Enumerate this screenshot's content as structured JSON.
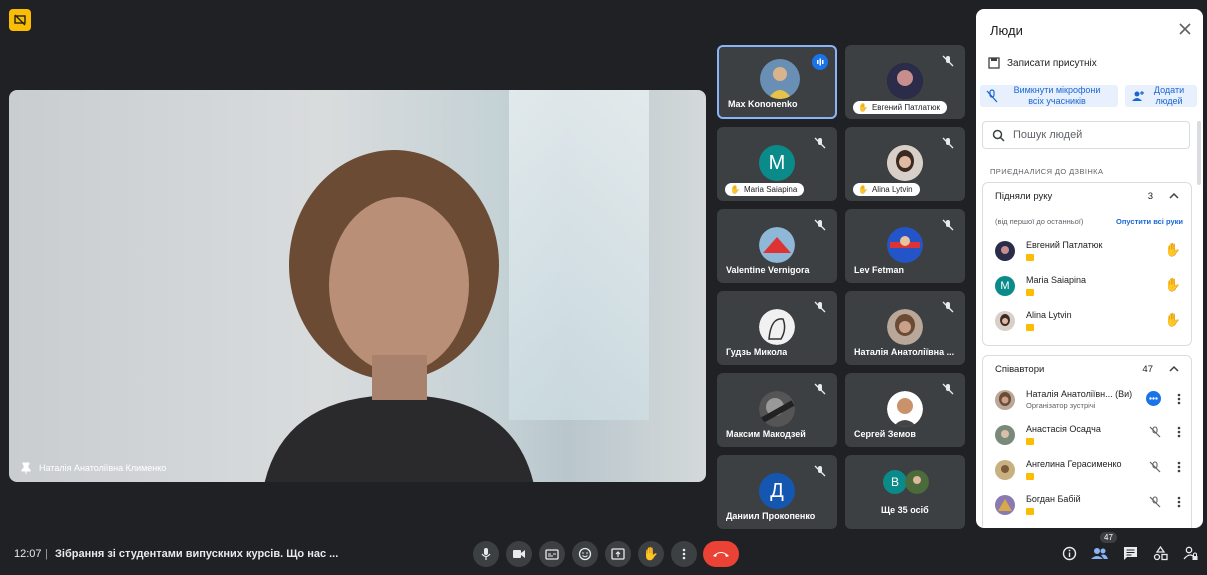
{
  "main_video": {
    "name": "Наталія Анатоліївна Клименко"
  },
  "tiles": [
    {
      "name": "Max Kononenko",
      "speaking": true
    },
    {
      "name": "Евгений Патлатюк",
      "hand_raised": true
    },
    {
      "name": "Maria Saiapina",
      "hand_raised": true,
      "initial": "M"
    },
    {
      "name": "Alina Lytvin",
      "hand_raised": true
    },
    {
      "name": "Valentine Vernigora"
    },
    {
      "name": "Lev Fetman"
    },
    {
      "name": "Гудзь Микола"
    },
    {
      "name": "Наталія Анатоліївна ..."
    },
    {
      "name": "Максим Макодзей"
    },
    {
      "name": "Сергей Земов"
    },
    {
      "name": "Даниил Прокопенко",
      "initial": "Д"
    },
    {
      "name": "Ще 35 осіб",
      "initial": "B"
    }
  ],
  "panel": {
    "title": "Люди",
    "record_label": "Записати присутніх",
    "mute_all_label": "Вимкнути мікрофони всіх учасників",
    "add_label": "Додати людей",
    "search_placeholder": "Пошук людей",
    "section_label": "ПРИЄДНАЛИСЯ ДО ДЗВІНКА",
    "raised": {
      "title": "Підняли руку",
      "count": "3",
      "order_text": "(від першої до останньої)",
      "lower_all": "Опустити всі руки",
      "people": [
        {
          "name": "Евгений Патлатюк"
        },
        {
          "name": "Maria Saiapina",
          "initial": "M"
        },
        {
          "name": "Alina Lytvin"
        }
      ]
    },
    "participants": {
      "title": "Співавтори",
      "count": "47",
      "people": [
        {
          "name": "Наталія Анатоліївн...",
          "you": "(Ви)",
          "sub": "Організатор зустрічі"
        },
        {
          "name": "Анастасія Осадча"
        },
        {
          "name": "Ангелина Герасименко"
        },
        {
          "name": "Богдан Бабій"
        }
      ]
    }
  },
  "bottom": {
    "time": "12:07",
    "separator": "|",
    "meeting_title": "Зібрання зі студентами випускних курсів. Що нас ...",
    "people_count": "47"
  },
  "colors": {
    "accent": "#1a73e8",
    "hangup": "#ea4335",
    "badge": "#fbbc04"
  }
}
